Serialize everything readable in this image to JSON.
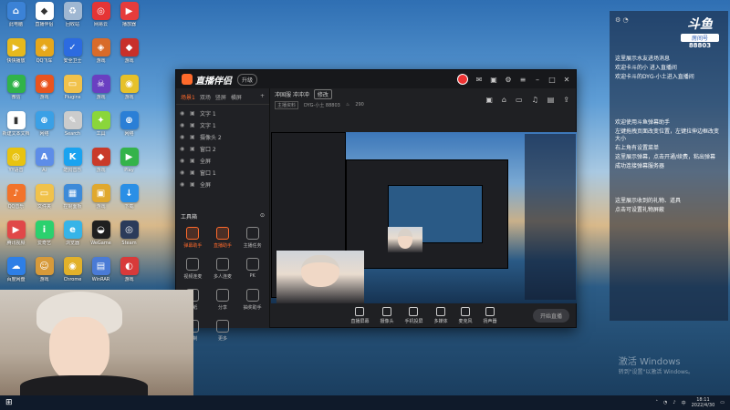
{
  "desktop_icons": [
    {
      "label": "此电脑",
      "color": "#3b82d6",
      "glyph": "⌂"
    },
    {
      "label": "快快播放",
      "color": "#e6b91e",
      "glyph": "▶"
    },
    {
      "label": "微信",
      "color": "#31b34a",
      "glyph": "◉"
    },
    {
      "label": "新建文本文档",
      "color": "#ffffff",
      "glyph": "▮"
    },
    {
      "label": "YY语音",
      "color": "#e8c310",
      "glyph": "◎"
    },
    {
      "label": "QQ音乐",
      "color": "#f2732a",
      "glyph": "♪"
    },
    {
      "label": "腾讯视频",
      "color": "#e04848",
      "glyph": "▶"
    },
    {
      "label": "百度网盘",
      "color": "#2e7fe6",
      "glyph": "☁"
    },
    {
      "label": "PS",
      "color": "#27a4e8",
      "glyph": "P"
    },
    {
      "label": "直播伴侣",
      "color": "#ffffff",
      "glyph": "◆"
    },
    {
      "label": "QQ飞车",
      "color": "#e6a71b",
      "glyph": "◈"
    },
    {
      "label": "游戏",
      "color": "#e9541f",
      "glyph": "◉"
    },
    {
      "label": "网络",
      "color": "#3aa0e6",
      "glyph": "⊕"
    },
    {
      "label": "Ai",
      "color": "#5d8de8",
      "glyph": "A"
    },
    {
      "label": "文件夹",
      "color": "#f1c24b",
      "glyph": "▭"
    },
    {
      "label": "爱奇艺",
      "color": "#2bd16e",
      "glyph": "i"
    },
    {
      "label": "游戏",
      "color": "#d79a3a",
      "glyph": "☺"
    },
    {
      "label": "游戏",
      "color": "#e04fa0",
      "glyph": "◐"
    },
    {
      "label": "回收站",
      "color": "#9fb7d2",
      "glyph": "♻"
    },
    {
      "label": "安全卫士",
      "color": "#2c6be0",
      "glyph": "✓"
    },
    {
      "label": "Plugins",
      "color": "#f1c24b",
      "glyph": "▭"
    },
    {
      "label": "Search",
      "color": "#cccccc",
      "glyph": "✎"
    },
    {
      "label": "酷狗音乐",
      "color": "#1aa3f0",
      "glyph": "K"
    },
    {
      "label": "控制面板",
      "color": "#3d8ad8",
      "glyph": "▦"
    },
    {
      "label": "浏览器",
      "color": "#36b4e8",
      "glyph": "e"
    },
    {
      "label": "Chrome",
      "color": "#e2b12a",
      "glyph": "◉"
    },
    {
      "label": "Edge",
      "color": "#2aa5dd",
      "glyph": "e"
    },
    {
      "label": "网易云",
      "color": "#e53535",
      "glyph": "◎"
    },
    {
      "label": "游戏",
      "color": "#d86b2a",
      "glyph": "◈"
    },
    {
      "label": "游戏",
      "color": "#6a3fc1",
      "glyph": "☠"
    },
    {
      "label": "工具",
      "color": "#8ad63a",
      "glyph": "✦"
    },
    {
      "label": "游戏",
      "color": "#c93a2a",
      "glyph": "◆"
    },
    {
      "label": "游戏",
      "color": "#e0a82e",
      "glyph": "▣"
    },
    {
      "label": "WeGame",
      "color": "#1f1f1f",
      "glyph": "◒"
    },
    {
      "label": "WinRAR",
      "color": "#4a7bd6",
      "glyph": "▤"
    },
    {
      "label": "QQ",
      "color": "#1a9ff0",
      "glyph": "◔"
    },
    {
      "label": "播放器",
      "color": "#e63c3c",
      "glyph": "▶"
    },
    {
      "label": "游戏",
      "color": "#c8302a",
      "glyph": "◆"
    },
    {
      "label": "游戏",
      "color": "#e6c12a",
      "glyph": "◉"
    },
    {
      "label": "网络",
      "color": "#2b7fd6",
      "glyph": "⊕"
    },
    {
      "label": "Play",
      "color": "#34b34a",
      "glyph": "▶"
    },
    {
      "label": "下载",
      "color": "#2a8fe6",
      "glyph": "↓"
    },
    {
      "label": "Steam",
      "color": "#2b3b5a",
      "glyph": "◎"
    },
    {
      "label": "游戏",
      "color": "#d83a3a",
      "glyph": "◐"
    }
  ],
  "app": {
    "title": "直播伴侣",
    "badge": "升级",
    "scene_tabs": [
      "场景1",
      "双场",
      "竖屏",
      "横屏"
    ],
    "sources": [
      "文字 1",
      "文字 1",
      "摄像头 2",
      "窗口 2",
      "全屏",
      "窗口 1",
      "全屏"
    ],
    "tools_title": "工具箱",
    "tools": [
      {
        "label": "弹幕助手",
        "active": true
      },
      {
        "label": "直播助手",
        "active": true
      },
      {
        "label": "主播任务",
        "active": false
      },
      {
        "label": "视频连麦",
        "active": false
      },
      {
        "label": "多人连麦",
        "active": false
      },
      {
        "label": "PK",
        "active": false
      },
      {
        "label": "贴纸",
        "active": false
      },
      {
        "label": "分享",
        "active": false
      },
      {
        "label": "抽奖助手",
        "active": false
      },
      {
        "label": "录制",
        "active": false
      },
      {
        "label": "更多",
        "active": false
      }
    ],
    "room_title": "冲国服 冲冲冲",
    "room_tag": "修改",
    "room_sub_tag": "主播资料",
    "room_sub_text": "DYG-小土 88803",
    "room_viewers": "290",
    "bottom_buttons": [
      "直播屏幕",
      "摄像头",
      "手机投屏",
      "多媒体",
      "麦克风",
      "扬声器"
    ],
    "start_label": "开始直播",
    "status_line": "当前帧率 30fps  CPU 12%  内存 52%  丢帧率 0%"
  },
  "chat": {
    "room_label": "房间号",
    "room_id": "88803",
    "messages": [
      "这里展示水友进场消息",
      "欢迎卡斗的小 进入直播间",
      "欢迎卡斗的DYG-小土进入直播间",
      "欢迎使用斗鱼弹幕助手",
      "左键拖拽页面改变位置，左键拉伸边框改变大小",
      "右上角有设置菜单",
      "这里展示弹幕，点击开通/续费，粘出弹幕",
      "成功连接弹幕服务器",
      "这里展示收到的礼物、道具",
      "点击可设置礼物屏蔽"
    ]
  },
  "taskbar": {
    "time": "18:11",
    "date": "2022/4/30"
  },
  "watermark": {
    "title": "激活 Windows",
    "sub": "转到\"设置\"以激活 Windows。"
  }
}
